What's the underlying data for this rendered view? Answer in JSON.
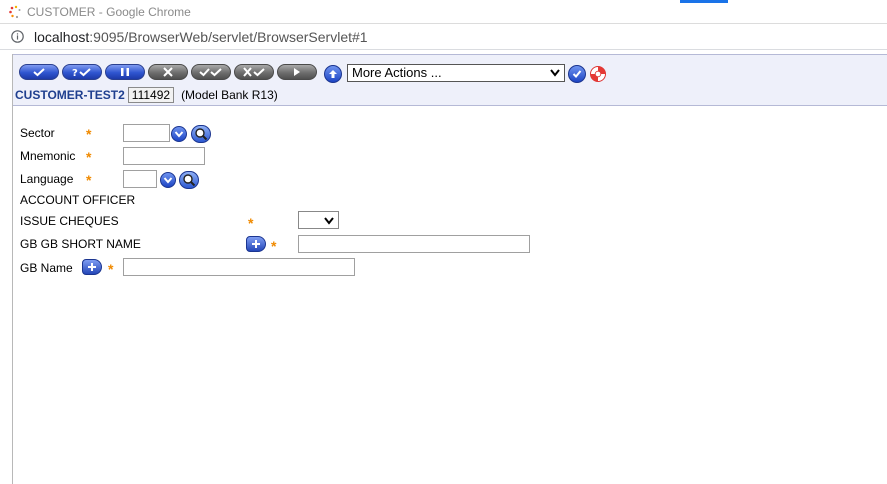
{
  "browser": {
    "window_title": "CUSTOMER - Google Chrome",
    "url_host": "localhost",
    "url_rest": ":9095/BrowserWeb/servlet/BrowserServlet#1"
  },
  "toolbar": {
    "buttons": [
      {
        "name": "commit-button",
        "icon": "check-icon",
        "style": "blue"
      },
      {
        "name": "validate-button",
        "icon": "question-check-icon",
        "style": "blue"
      },
      {
        "name": "hold-button",
        "icon": "pause-icon",
        "style": "blue"
      },
      {
        "name": "delete-button",
        "icon": "x-icon",
        "style": "grey"
      },
      {
        "name": "authorise-button",
        "icon": "double-check-icon",
        "style": "grey"
      },
      {
        "name": "reverse-button",
        "icon": "x-check-icon",
        "style": "grey"
      },
      {
        "name": "next-button",
        "icon": "triangle-right-icon",
        "style": "grey"
      }
    ],
    "more_actions_label": "More Actions ...",
    "colors": {
      "blue": "#2f55d0",
      "grey": "#6e6e6e",
      "toolbar_bg": "#eef0fa"
    }
  },
  "record": {
    "name": "CUSTOMER-TEST2",
    "id": "111492",
    "description": "(Model Bank R13)"
  },
  "form": {
    "sector_label": "Sector",
    "mnemonic_label": "Mnemonic",
    "language_label": "Language",
    "account_officer_label": "ACCOUNT OFFICER",
    "issue_cheques_label": "ISSUE CHEQUES",
    "gb_short_name_label": "GB GB SHORT NAME",
    "gb_name_label": "GB Name",
    "required_mark": "*",
    "required_color": "#f08a00"
  }
}
